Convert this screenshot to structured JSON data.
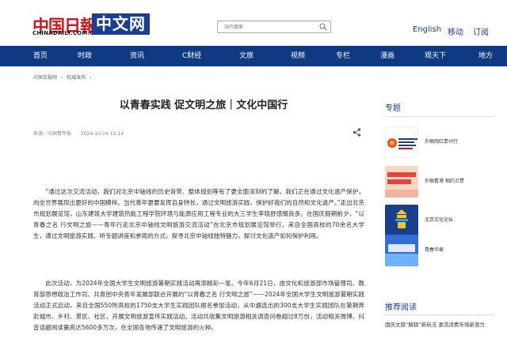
{
  "header": {
    "logo_text": "中国日報",
    "logo_sub": "CHINADAILY.COM.CN",
    "logo_box": "中文网",
    "search_placeholder": "站内搜索",
    "links": [
      "English",
      "移动",
      "订阅"
    ]
  },
  "nav": {
    "items": [
      "首页",
      "时政",
      "资讯",
      "C财经",
      "文旅",
      "视频",
      "专栏",
      "漫画",
      "观天下",
      "地方"
    ]
  },
  "breadcrumb": [
    "中国日报网",
    "›",
    "权威发布",
    "›"
  ],
  "article": {
    "title": "以青春实践 促文明之旅｜文化中国行",
    "source": "来源：中国青年报",
    "date": "2024-10-04 15:14",
    "paragraphs": [
      "“通过这次交流活动，我们对北京中轴线的历史背景、整体规划等有了更全面深刻的了解。我们正在通过文化遗产保护，向全世界展现出更好的中国模样。当代青年更要发挥自身特长，通过文明旅游实践，保护好我们的自然和文化遗产。”走出北京市规划展览馆，山东建筑大学建筑热能工程学院环境与能源应用工程专业的大三学生李晓舒感慨良多。在国庆假期前夕，“以青春之名 行文明之旅——青年行走北京中轴线文明旅游交流活动”在北京市规划展览馆举行，来自全国高校的70余名大学生，通过文明旅游实践、听专题讲座和参观的方式，探寻北京中轴线独特魅力，探讨文化遗产如何保护利用。",
      "此次活动，为2024年全国大学生文明旅游暑期实践活动再添精彩一笔。今年6月21日，由文化和旅游部市场管理司、教育部思想政治工作司、共青团中央青年发展部联合开展的“以青春之名 行文明之旅”——2024年全国大学生文明旅游暑期实践活动正式启动，来自全国550所高校的1750支大学生实践团队报名参加活动，从中遴选出的300支大学生实践团队在暑期奔赴城市、乡村、景区、社区，开展文明旅游宣传实践活动。活动共收集文明旅游相关调查问卷超过8万份，活动相关微博、抖音话题阅读量高达5600多万次，在全国各地传递了文明旅游的火种。"
    ]
  },
  "sidebar": {
    "heading": "专题",
    "items": [
      {
        "label": "外眼网红贵州行",
        "thumb_text": "China Storyteller Partnerships Visit China\n中国故事传播者·贵州",
        "thumb_color": "#ffffff"
      },
      {
        "label": "外眼看港 相约点赞",
        "thumb_text": "外眼看港 相约点赞",
        "thumb_color": "#f7d7c4"
      },
      {
        "label": "北京文化论坛",
        "thumb_text": "",
        "thumb_color": "#1a3f8a"
      },
      {
        "label": "青春华章",
        "thumb_text": "青春华章",
        "thumb_color": "#2f6fd6"
      }
    ],
    "rec_heading": "推荐阅读",
    "rec_text": "国庆文旅“解锁”新玩法 激活消费市场新潜力"
  }
}
